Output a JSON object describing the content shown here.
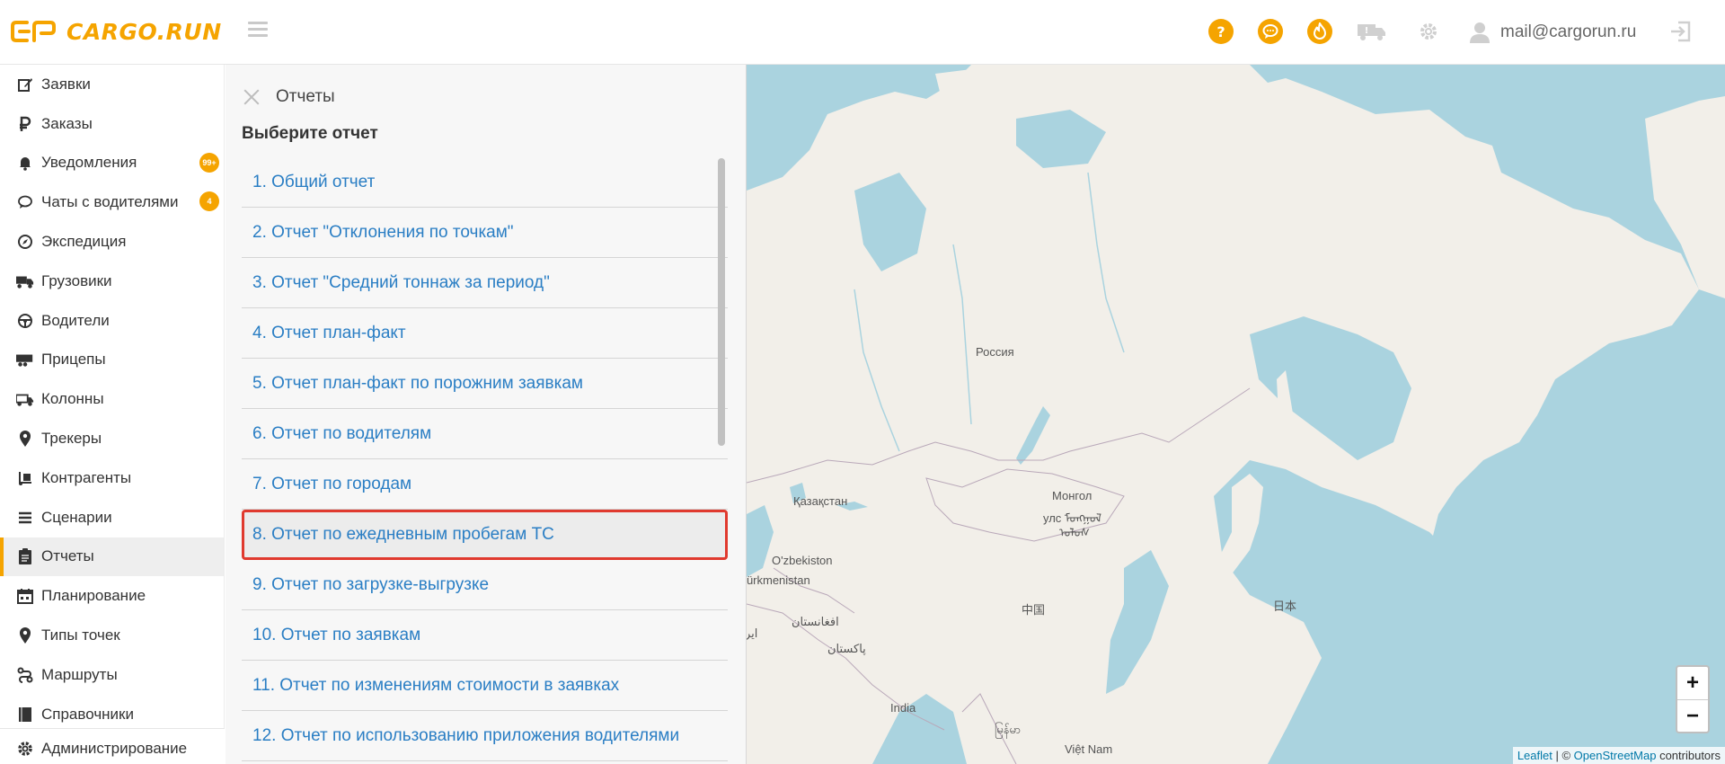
{
  "header": {
    "logo_text": "CARGO.RUN",
    "user_email": "mail@cargorun.ru",
    "accent_color": "#f5a400"
  },
  "sidebar": {
    "items": [
      {
        "label": "Заявки",
        "icon": "edit-icon"
      },
      {
        "label": "Заказы",
        "icon": "ruble-icon"
      },
      {
        "label": "Уведомления",
        "icon": "bell-icon",
        "badge": "99+"
      },
      {
        "label": "Чаты с водителями",
        "icon": "chat-icon",
        "badge": "4"
      },
      {
        "label": "Экспедиция",
        "icon": "compass-icon"
      },
      {
        "label": "Грузовики",
        "icon": "truck-icon"
      },
      {
        "label": "Водители",
        "icon": "steering-wheel-icon"
      },
      {
        "label": "Прицепы",
        "icon": "trailer-icon"
      },
      {
        "label": "Колонны",
        "icon": "convoy-icon"
      },
      {
        "label": "Трекеры",
        "icon": "map-pin-icon"
      },
      {
        "label": "Контрагенты",
        "icon": "dolly-icon"
      },
      {
        "label": "Сценарии",
        "icon": "list-icon"
      },
      {
        "label": "Отчеты",
        "icon": "clipboard-icon",
        "active": true
      },
      {
        "label": "Планирование",
        "icon": "calendar-icon"
      },
      {
        "label": "Типы точек",
        "icon": "map-pin-icon"
      },
      {
        "label": "Маршруты",
        "icon": "route-icon"
      },
      {
        "label": "Справочники",
        "icon": "book-icon"
      }
    ],
    "bottom_item": {
      "label": "Администрирование",
      "icon": "gear-icon"
    }
  },
  "reports_panel": {
    "title": "Отчеты",
    "subtitle": "Выберите отчет",
    "reports": [
      "1. Общий отчет",
      "2. Отчет \"Отклонения по точкам\"",
      "3. Отчет \"Средний тоннаж за период\"",
      "4. Отчет план-факт",
      "5. Отчет план-факт по порожним заявкам",
      "6. Отчет по водителям",
      "7. Отчет по городам",
      "8. Отчет по ежедневным пробегам ТС",
      "9. Отчет по загрузке-выгрузке",
      "10. Отчет по заявкам",
      "11. Отчет по изменениям стоимости в заявках",
      "12. Отчет по использованию приложения водителями"
    ],
    "selected_index": 7
  },
  "map": {
    "labels": [
      "Россия",
      "Қазақстан",
      "Монгол",
      "улс ᠮᠣᠩᠭᠣᠯ",
      "ᠤᠯᠤᠰ",
      "O'zbekiston",
      "Türkmenistan",
      "افغانستان",
      "پاکستان",
      "中国",
      "日本",
      "India",
      "Việt Nam",
      "ایر",
      "မြန်မာ"
    ],
    "zoom_in": "+",
    "zoom_out": "−",
    "attribution": {
      "leaflet": "Leaflet",
      "separator": " | © ",
      "osm": "OpenStreetMap",
      "suffix": " contributors"
    },
    "land_color": "#f2efe9",
    "water_color": "#aad3df"
  }
}
